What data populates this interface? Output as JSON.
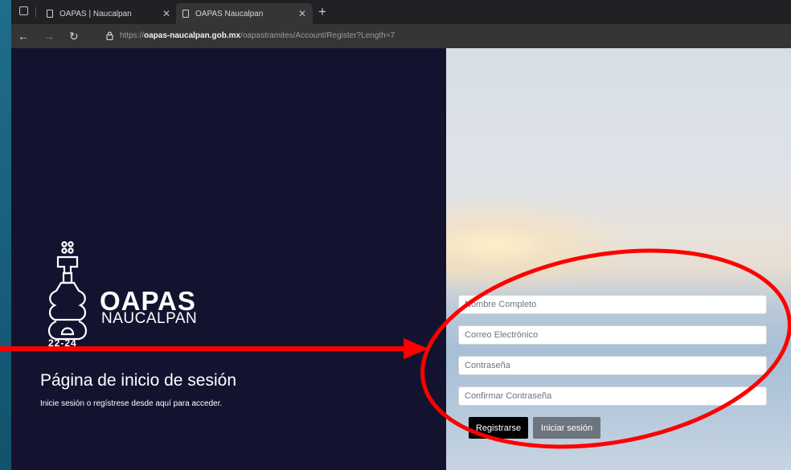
{
  "browser": {
    "tabs": [
      {
        "label": "OAPAS | Naucalpan",
        "active": false
      },
      {
        "label": "OAPAS Naucalpan",
        "active": true
      }
    ],
    "url_prefix": "https://",
    "url_host": "oapas-naucalpan.gob.mx",
    "url_path": "/oapastramites/Account/Register?Length=7"
  },
  "brand": {
    "name": "OAPAS",
    "subname": "NAUCALPAN",
    "years": "22-24"
  },
  "page": {
    "title": "Página de inicio de sesión",
    "subtitle": "Inicie sesión o regístrese desde aquí para acceder."
  },
  "form": {
    "full_name_placeholder": "Nombre Completo",
    "email_placeholder": "Correo Electrónico",
    "password_placeholder": "Contraseña",
    "confirm_password_placeholder": "Confirmar Contraseña",
    "register_label": "Registrarse",
    "login_label": "Iniciar sesión"
  },
  "annotation": {
    "color": "#ff0000"
  }
}
